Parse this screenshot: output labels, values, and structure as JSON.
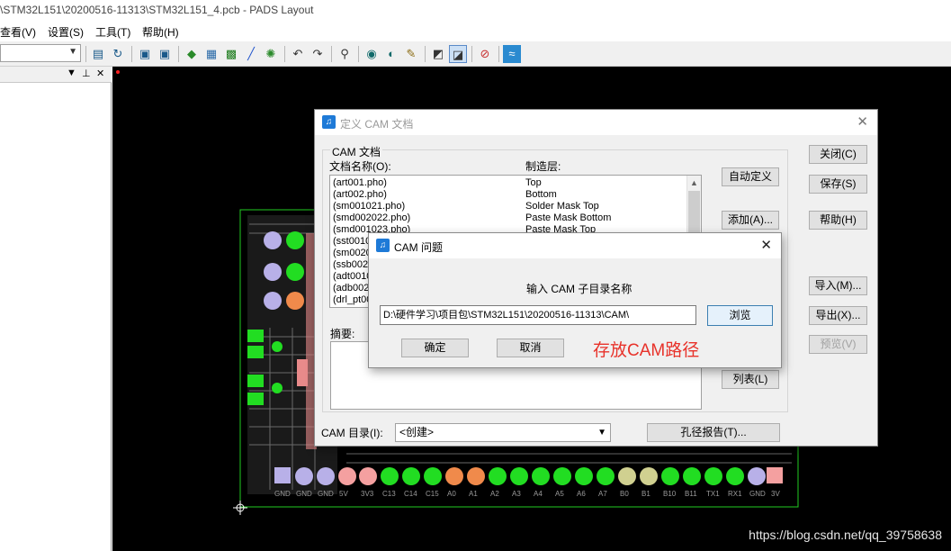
{
  "window": {
    "title": "\\STM32L151\\20200516-11313\\STM32L151_4.pcb - PADS Layout"
  },
  "menu": {
    "items": [
      "查看(V)",
      "设置(S)",
      "工具(T)",
      "帮助(H)"
    ]
  },
  "colors": {
    "canvas_bg": "#000000",
    "board_outline": "#00ff00",
    "pad_green": "#22dd22",
    "pad_orange": "#f08a4b",
    "pad_lavender": "#b8b0e8",
    "pad_pink": "#f4a0a0",
    "annotation_red": "#e8322a",
    "dialog_icon": "#1e7ad7"
  },
  "cam_dialog": {
    "title": "定义 CAM 文档",
    "group_label": "CAM 文档",
    "col_name": "文档名称(O):",
    "col_layer": "制造层:",
    "rows": [
      {
        "name": "(art001.pho)",
        "layer": "Top"
      },
      {
        "name": "(art002.pho)",
        "layer": "Bottom"
      },
      {
        "name": "(sm001021.pho)",
        "layer": "Solder Mask Top"
      },
      {
        "name": "(smd002022.pho)",
        "layer": "Paste Mask Bottom"
      },
      {
        "name": "(smd001023.pho)",
        "layer": "Paste Mask Top"
      },
      {
        "name": "(sst0010",
        "layer": ""
      },
      {
        "name": "(sm0020",
        "layer": ""
      },
      {
        "name": "(ssb002",
        "layer": ""
      },
      {
        "name": "(adt0010",
        "layer": ""
      },
      {
        "name": "(adb002",
        "layer": ""
      },
      {
        "name": "(drl_pt00",
        "layer": ""
      }
    ],
    "summary_label": "摘要:",
    "cam_dir_label": "CAM 目录(I):",
    "cam_dir_value": "<创建>",
    "buttons": {
      "auto_define": "自动定义",
      "add": "添加(A)...",
      "list": "列表(L)",
      "drill_report": "孔径报告(T)...",
      "close": "关闭(C)",
      "save": "保存(S)",
      "help": "帮助(H)",
      "import": "导入(M)...",
      "export": "导出(X)...",
      "preview": "预览(V)"
    }
  },
  "question_dialog": {
    "title": "CAM 问题",
    "prompt": "输入 CAM 子目录名称",
    "path_value": "D:\\硬件学习\\项目包\\STM32L151\\20200516-11313\\CAM\\",
    "browse": "浏览",
    "ok": "确定",
    "cancel": "取消",
    "annotation": "存放CAM路径"
  },
  "board": {
    "bottom_labels": [
      "GND",
      "GND",
      "GND",
      "5V",
      "3V3",
      "C13",
      "C14",
      "C15",
      "A0",
      "A1",
      "A2",
      "A3",
      "A4",
      "A5",
      "A6",
      "A7",
      "B0",
      "B1",
      "B10",
      "B11",
      "TX1",
      "RX1",
      "GND",
      "3V"
    ]
  },
  "watermark": "https://blog.csdn.net/qq_39758638"
}
